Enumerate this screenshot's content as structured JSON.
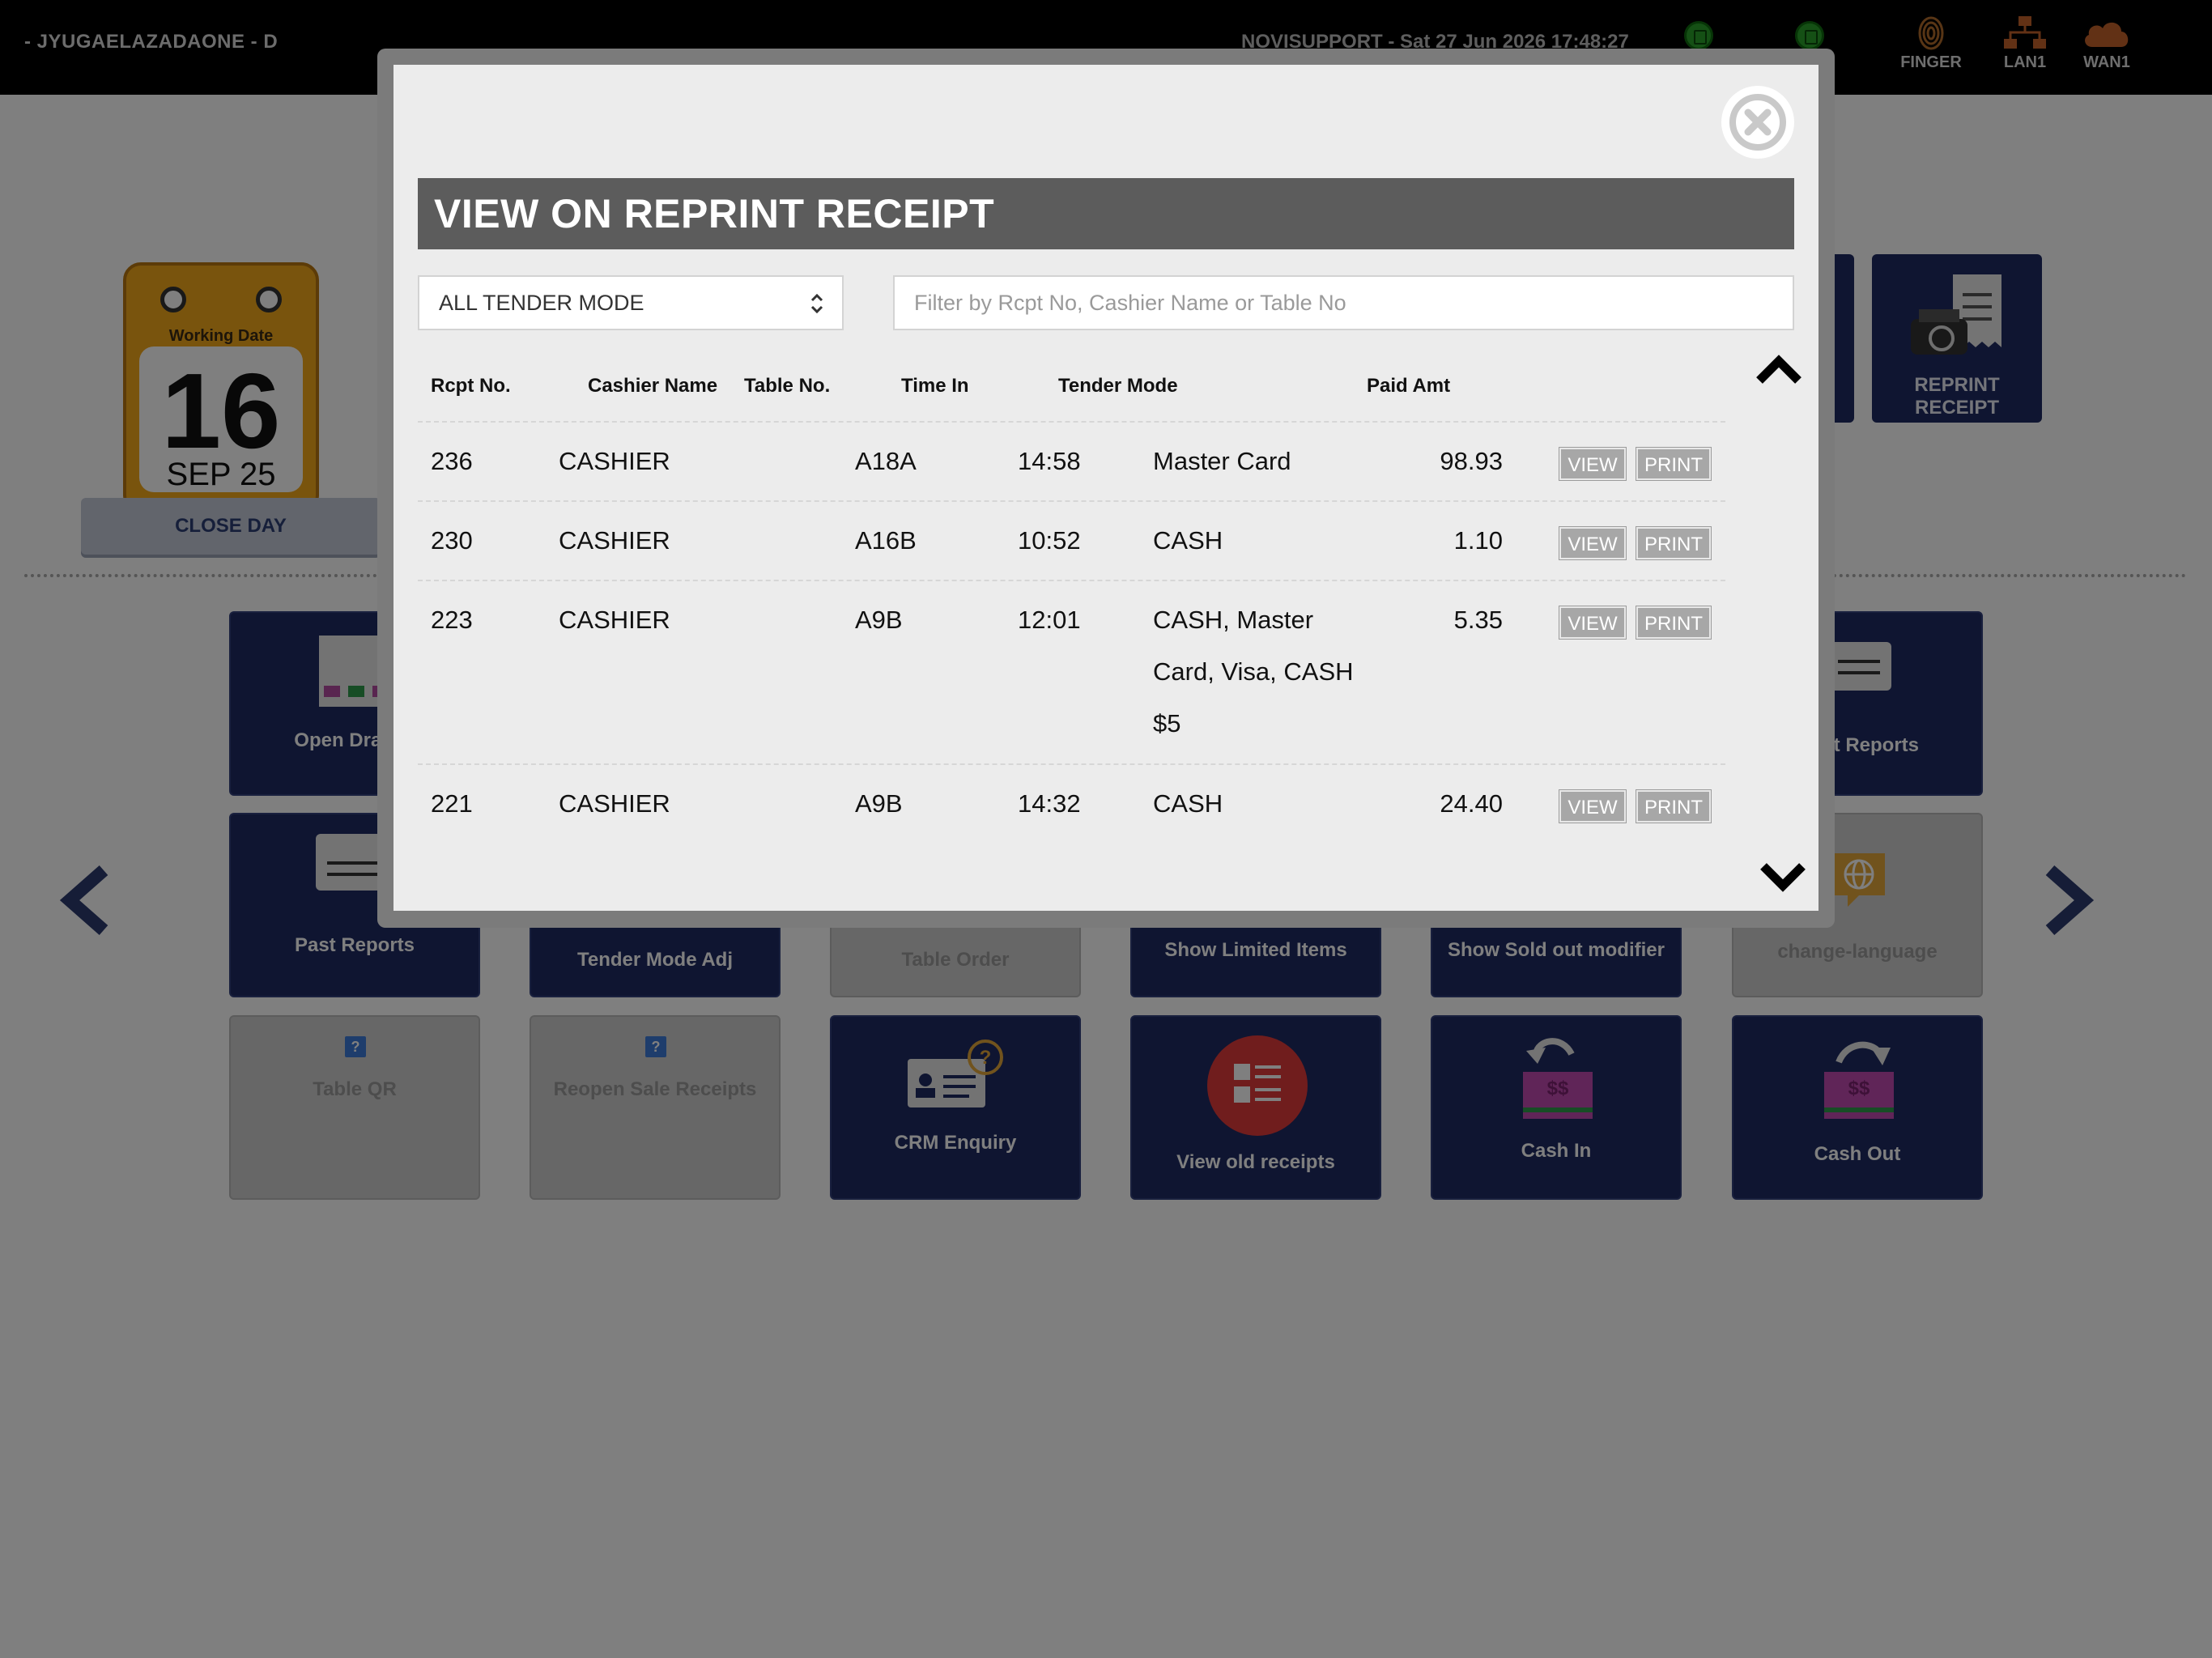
{
  "topbar": {
    "store_name": "- JYUGAELAZADAONE - D",
    "support_text": "NOVISUPPORT  - Sat 27 Jun 2026 17:48:27",
    "indicators": [
      {
        "icon": "fingerprint-icon",
        "label": "FINGER"
      },
      {
        "icon": "network-icon",
        "label": "LAN1"
      },
      {
        "icon": "cloud-icon",
        "label": "WAN1"
      }
    ],
    "status_color": "#2aa12a"
  },
  "calendar": {
    "caption": "Working Date",
    "day": "16",
    "month_year": "SEP 25"
  },
  "close_day_label": "CLOSE DAY",
  "reprint_tile_label": "REPRINT RECEIPT",
  "tiles": {
    "open_drawer": "Open Drawer",
    "print_reports": "Print Reports",
    "past_reports": "Past Reports",
    "tender_mode_adj": "Tender Mode Adj",
    "table_order": "Table Order",
    "show_limited_items": "Show Limited Items",
    "show_sold_out_modifier": "Show Sold out modifier",
    "change_language": "change-language",
    "table_qr": "Table QR",
    "reopen_sale_receipts": "Reopen Sale Receipts",
    "crm_enquiry": "CRM Enquiry",
    "view_old_receipts": "View old receipts",
    "cash_in": "Cash In",
    "cash_out": "Cash Out"
  },
  "modal": {
    "title": "VIEW ON REPRINT RECEIPT",
    "tender_select": "ALL TENDER MODE",
    "filter_placeholder": "Filter by Rcpt No, Cashier Name or Table No",
    "columns": {
      "rcpt_no": "Rcpt No.",
      "cashier_name": "Cashier Name",
      "table_no": "Table No.",
      "time_in": "Time In",
      "tender_mode": "Tender Mode",
      "paid_amt": "Paid Amt"
    },
    "view_label": "VIEW",
    "print_label": "PRINT",
    "rows": [
      {
        "rcpt": "236",
        "cashier": "CASHIER",
        "table": "A18A",
        "time": "14:58",
        "tender_lines": [
          "Master Card"
        ],
        "amt": "98.93"
      },
      {
        "rcpt": "230",
        "cashier": "CASHIER",
        "table": "A16B",
        "time": "10:52",
        "tender_lines": [
          "CASH"
        ],
        "amt": "1.10"
      },
      {
        "rcpt": "223",
        "cashier": "CASHIER",
        "table": "A9B",
        "time": "12:01",
        "tender_lines": [
          "CASH, Master",
          "Card, Visa, CASH",
          "$5"
        ],
        "amt": "5.35"
      },
      {
        "rcpt": "221",
        "cashier": "CASHIER",
        "table": "A9B",
        "time": "14:32",
        "tender_lines": [
          "CASH"
        ],
        "amt": "24.40"
      }
    ]
  },
  "colors": {
    "tile_navy": "#1f2b63",
    "calendar_gold": "#f3a81b",
    "modal_title_bg": "#5c5c5c"
  }
}
